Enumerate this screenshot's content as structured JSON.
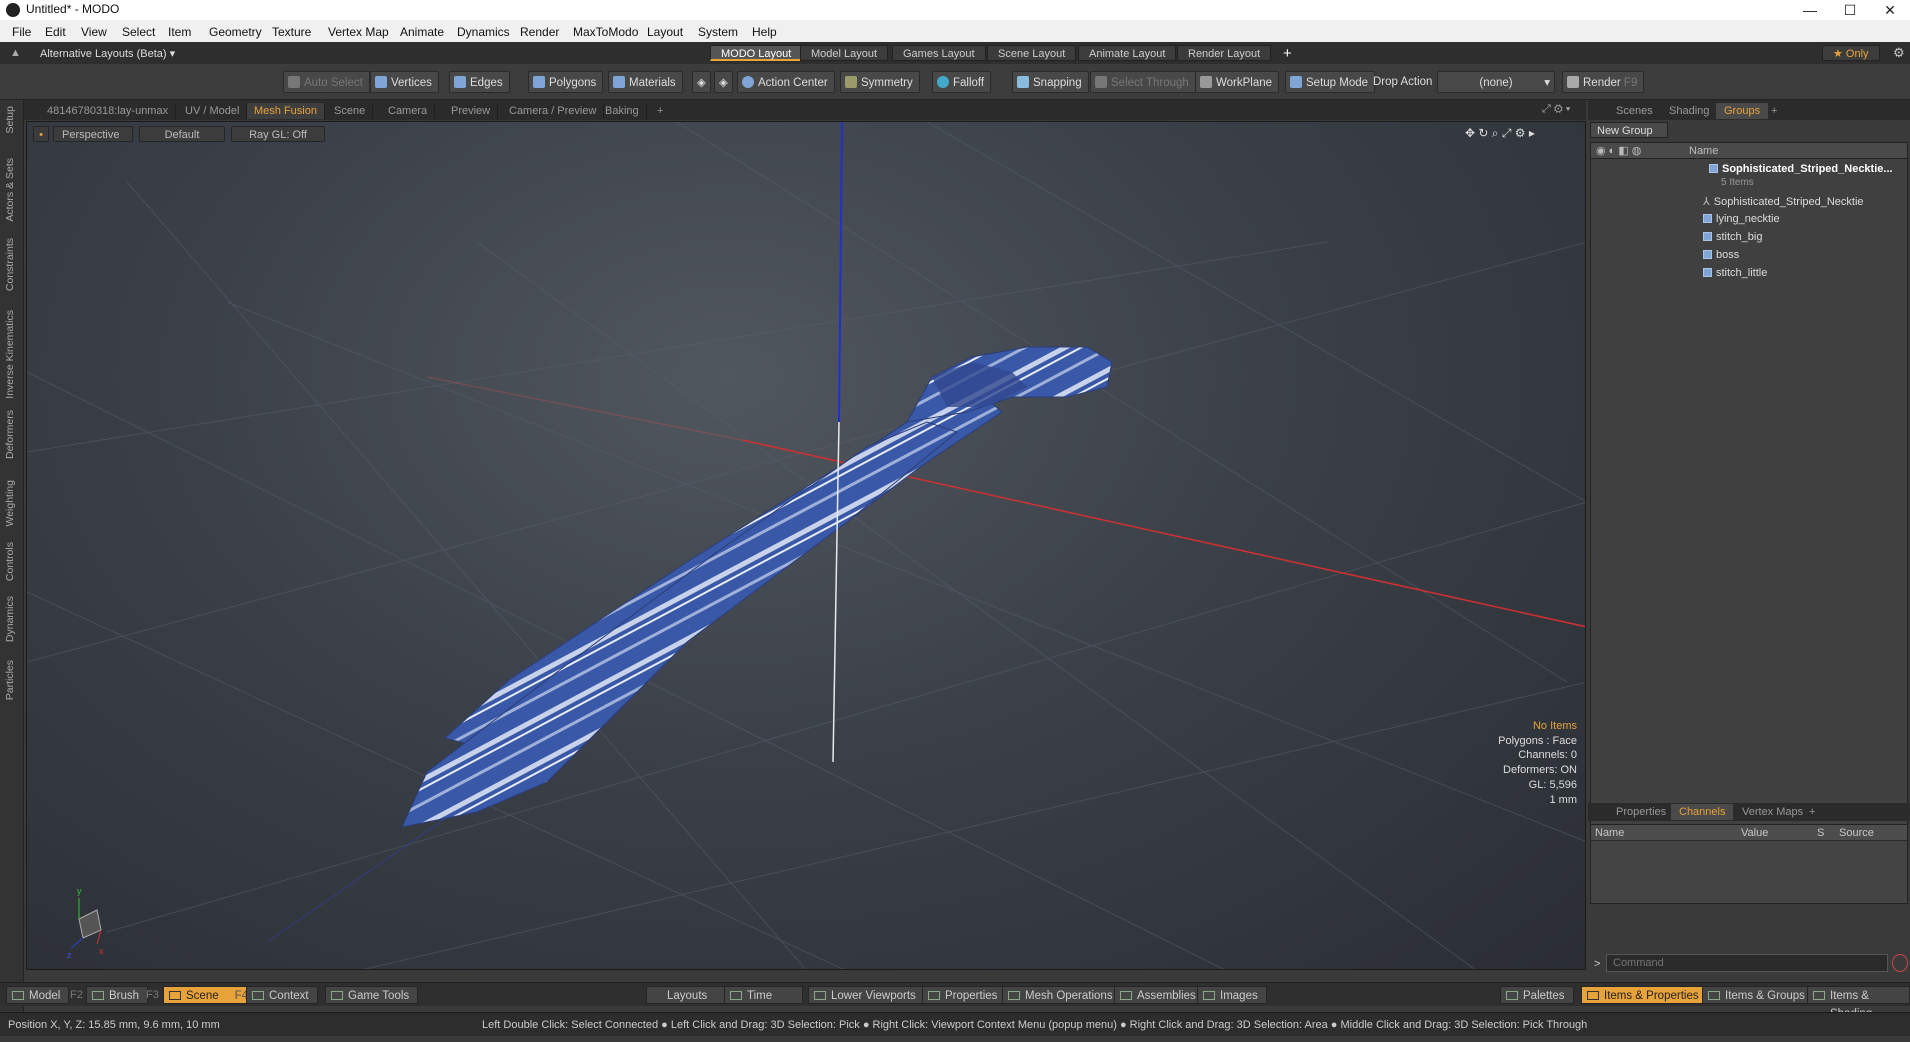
{
  "titlebar": {
    "title": "Untitled* - MODO",
    "minimize": "—",
    "maximize": "☐",
    "close": "✕"
  },
  "menubar": {
    "items": [
      "File",
      "Edit",
      "View",
      "Select",
      "Item",
      "Geometry",
      "Texture",
      "Vertex Map",
      "Animate",
      "Dynamics",
      "Render",
      "MaxToModo",
      "Layout",
      "System",
      "Help"
    ]
  },
  "layoutbar": {
    "alt_layouts": "Alternative Layouts (Beta) ▾",
    "tabs": [
      "MODO Layout",
      "Model Layout",
      "Games Layout",
      "Scene Layout",
      "Animate Layout",
      "Render Layout"
    ],
    "add": "+",
    "only": "★ Only"
  },
  "toolbar": {
    "auto_select": "Auto Select",
    "vertices": "Vertices",
    "edges": "Edges",
    "polygons": "Polygons",
    "materials": "Materials",
    "action_center": "Action Center",
    "symmetry": "Symmetry",
    "falloff": "Falloff",
    "snapping": "Snapping",
    "select_through": "Select Through",
    "workplane": "WorkPlane",
    "setup_mode": "Setup Mode",
    "drop_action": "Drop Action",
    "drop_value": "(none)",
    "render": "Render",
    "render_key": "F9"
  },
  "left_tabs": [
    "Setup",
    "Actors & Sets",
    "Constraints",
    "Inverse Kinematics",
    "Deformers",
    "Weighting",
    "Controls",
    "Dynamics",
    "Particles"
  ],
  "viewport_tabs": [
    "48146780318:lay-unmax",
    "UV / Model",
    "Mesh Fusion",
    "Scene",
    "Camera",
    "Preview",
    "Camera / Preview",
    "Baking",
    "+"
  ],
  "viewport": {
    "view": "Perspective",
    "shading": "Default",
    "raygl": "Ray GL: Off",
    "stats": {
      "items": "No Items",
      "polygons": "Polygons : Face",
      "channels": "Channels: 0",
      "deformers": "Deformers: ON",
      "gl": "GL: 5,596",
      "unit": "1 mm"
    }
  },
  "right_panel": {
    "tabs": [
      "Scenes",
      "Shading",
      "Groups",
      "+"
    ],
    "new_group": "New Group",
    "col_name": "Name",
    "group_name": "Sophisticated_Striped_Necktie...",
    "group_count": "5 Items",
    "items": [
      "Sophisticated_Striped_Necktie",
      "lying_necktie",
      "stitch_big",
      "boss",
      "stitch_little"
    ]
  },
  "props_panel": {
    "tabs": [
      "Properties",
      "Channels",
      "Vertex Maps",
      "+"
    ],
    "columns": [
      "Name",
      "Value",
      "S",
      "Source"
    ],
    "command_placeholder": "Command",
    "prompt": ">"
  },
  "bottombar": {
    "model": "Model",
    "model_key": "F2",
    "brush": "Brush",
    "brush_key": "F3",
    "scene": "Scene",
    "scene_key": "F4",
    "context": "Context",
    "game_tools": "Game Tools",
    "layouts": "Layouts",
    "time": "Time",
    "lower_viewports": "Lower Viewports",
    "properties": "Properties",
    "mesh_operations": "Mesh Operations",
    "assemblies": "Assemblies",
    "images": "Images",
    "palettes": "Palettes",
    "items_properties": "Items & Properties",
    "items_groups": "Items & Groups",
    "items_shading": "Items & Shading"
  },
  "statusbar": {
    "position": "Position X, Y, Z:   15.85 mm, 9.6 mm, 10 mm",
    "hints": "Left Double Click: Select Connected ● Left Click and Drag: 3D Selection: Pick ● Right Click: Viewport Context Menu (popup menu) ● Right Click and Drag: 3D Selection: Area ● Middle Click and Drag: 3D Selection: Pick Through"
  },
  "colors": {
    "accent": "#e8a23a",
    "mesh": "#3d5da8",
    "x_axis": "#d03030",
    "y_axis": "#2030d0"
  }
}
